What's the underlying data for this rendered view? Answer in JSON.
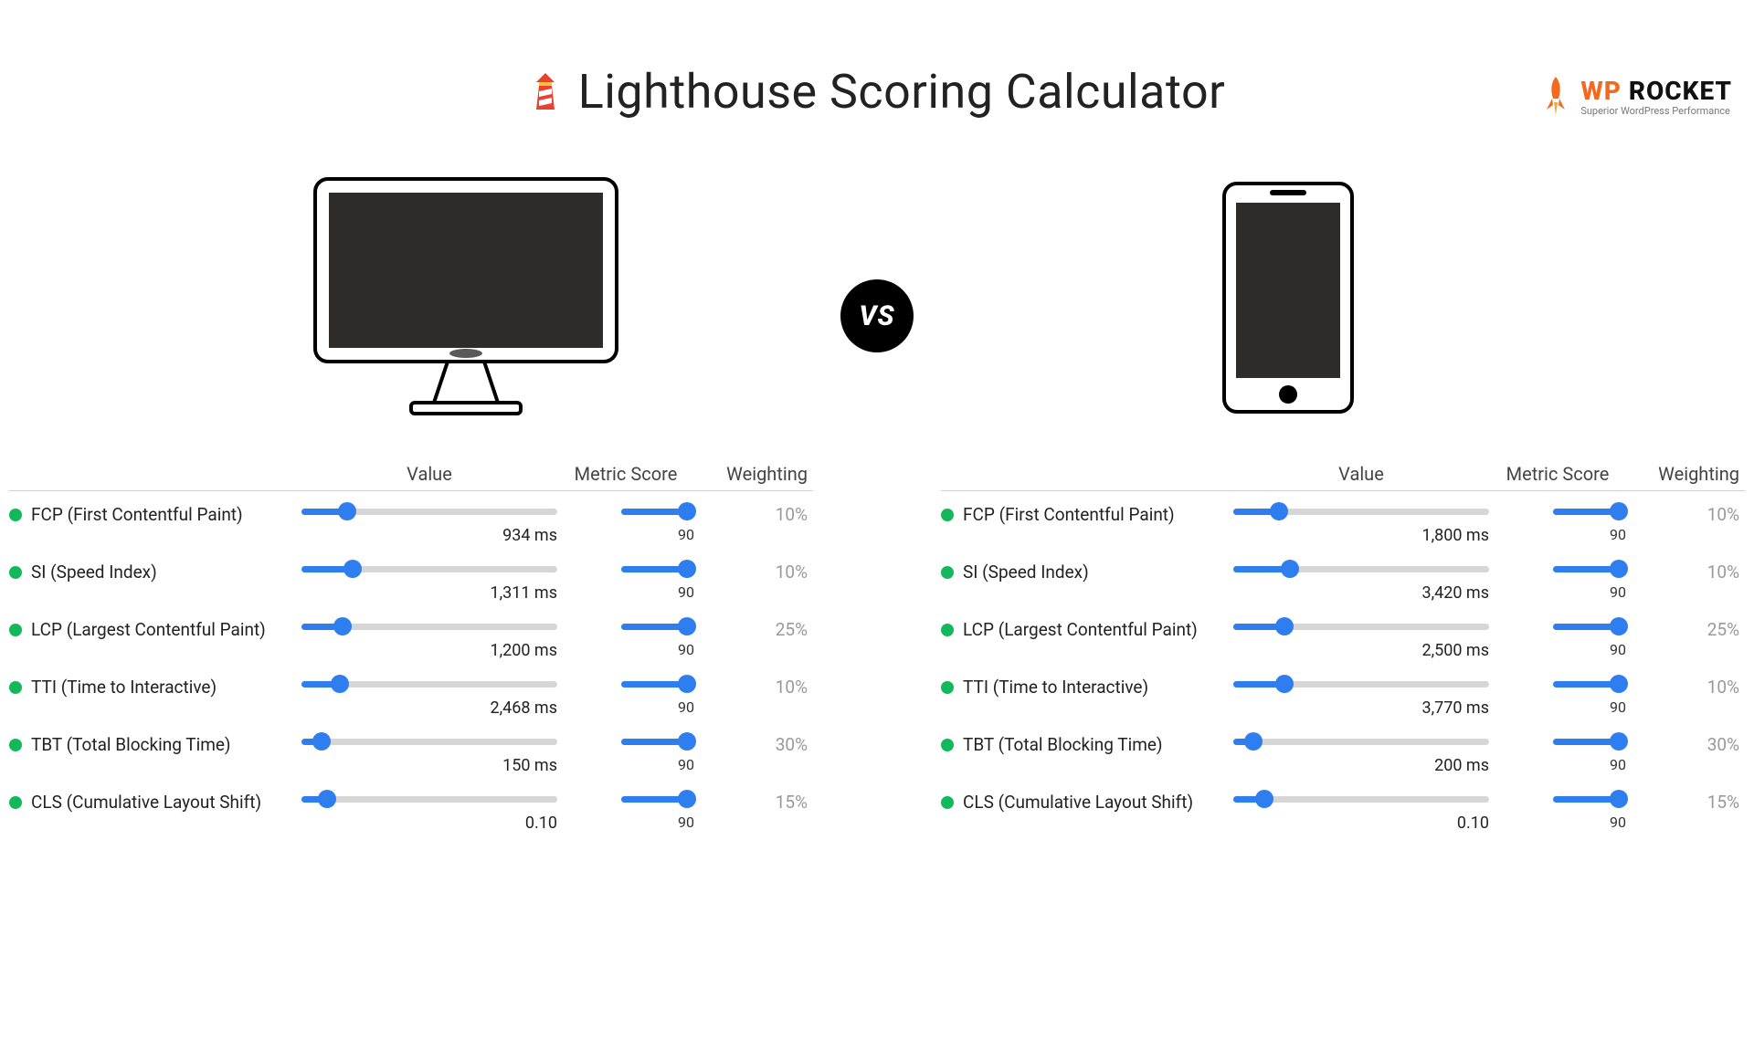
{
  "brand": {
    "wp": "WP",
    "rocket": "ROCKET",
    "tagline": "Superior WordPress Performance"
  },
  "title": "Lighthouse Scoring Calculator",
  "vs_label": "VS",
  "headers": {
    "value": "Value",
    "score": "Metric Score",
    "weight": "Weighting"
  },
  "panels": [
    {
      "device": "desktop",
      "metrics": [
        {
          "name": "FCP (First Contentful Paint)",
          "value": "934 ms",
          "value_pct": 18,
          "score": "90",
          "score_pct": 90,
          "weight": "10%"
        },
        {
          "name": "SI (Speed Index)",
          "value": "1,311 ms",
          "value_pct": 20,
          "score": "90",
          "score_pct": 90,
          "weight": "10%"
        },
        {
          "name": "LCP (Largest Contentful Paint)",
          "value": "1,200 ms",
          "value_pct": 16,
          "score": "90",
          "score_pct": 90,
          "weight": "25%"
        },
        {
          "name": "TTI (Time to Interactive)",
          "value": "2,468 ms",
          "value_pct": 15,
          "score": "90",
          "score_pct": 90,
          "weight": "10%"
        },
        {
          "name": "TBT (Total Blocking Time)",
          "value": "150 ms",
          "value_pct": 8,
          "score": "90",
          "score_pct": 90,
          "weight": "30%"
        },
        {
          "name": "CLS (Cumulative Layout Shift)",
          "value": "0.10",
          "value_pct": 10,
          "score": "90",
          "score_pct": 90,
          "weight": "15%"
        }
      ]
    },
    {
      "device": "mobile",
      "metrics": [
        {
          "name": "FCP (First Contentful Paint)",
          "value": "1,800 ms",
          "value_pct": 18,
          "score": "90",
          "score_pct": 90,
          "weight": "10%"
        },
        {
          "name": "SI (Speed Index)",
          "value": "3,420 ms",
          "value_pct": 22,
          "score": "90",
          "score_pct": 90,
          "weight": "10%"
        },
        {
          "name": "LCP (Largest Contentful Paint)",
          "value": "2,500 ms",
          "value_pct": 20,
          "score": "90",
          "score_pct": 90,
          "weight": "25%"
        },
        {
          "name": "TTI (Time to Interactive)",
          "value": "3,770 ms",
          "value_pct": 20,
          "score": "90",
          "score_pct": 90,
          "weight": "10%"
        },
        {
          "name": "TBT (Total Blocking Time)",
          "value": "200 ms",
          "value_pct": 8,
          "score": "90",
          "score_pct": 90,
          "weight": "30%"
        },
        {
          "name": "CLS (Cumulative Layout Shift)",
          "value": "0.10",
          "value_pct": 12,
          "score": "90",
          "score_pct": 90,
          "weight": "15%"
        }
      ]
    }
  ]
}
